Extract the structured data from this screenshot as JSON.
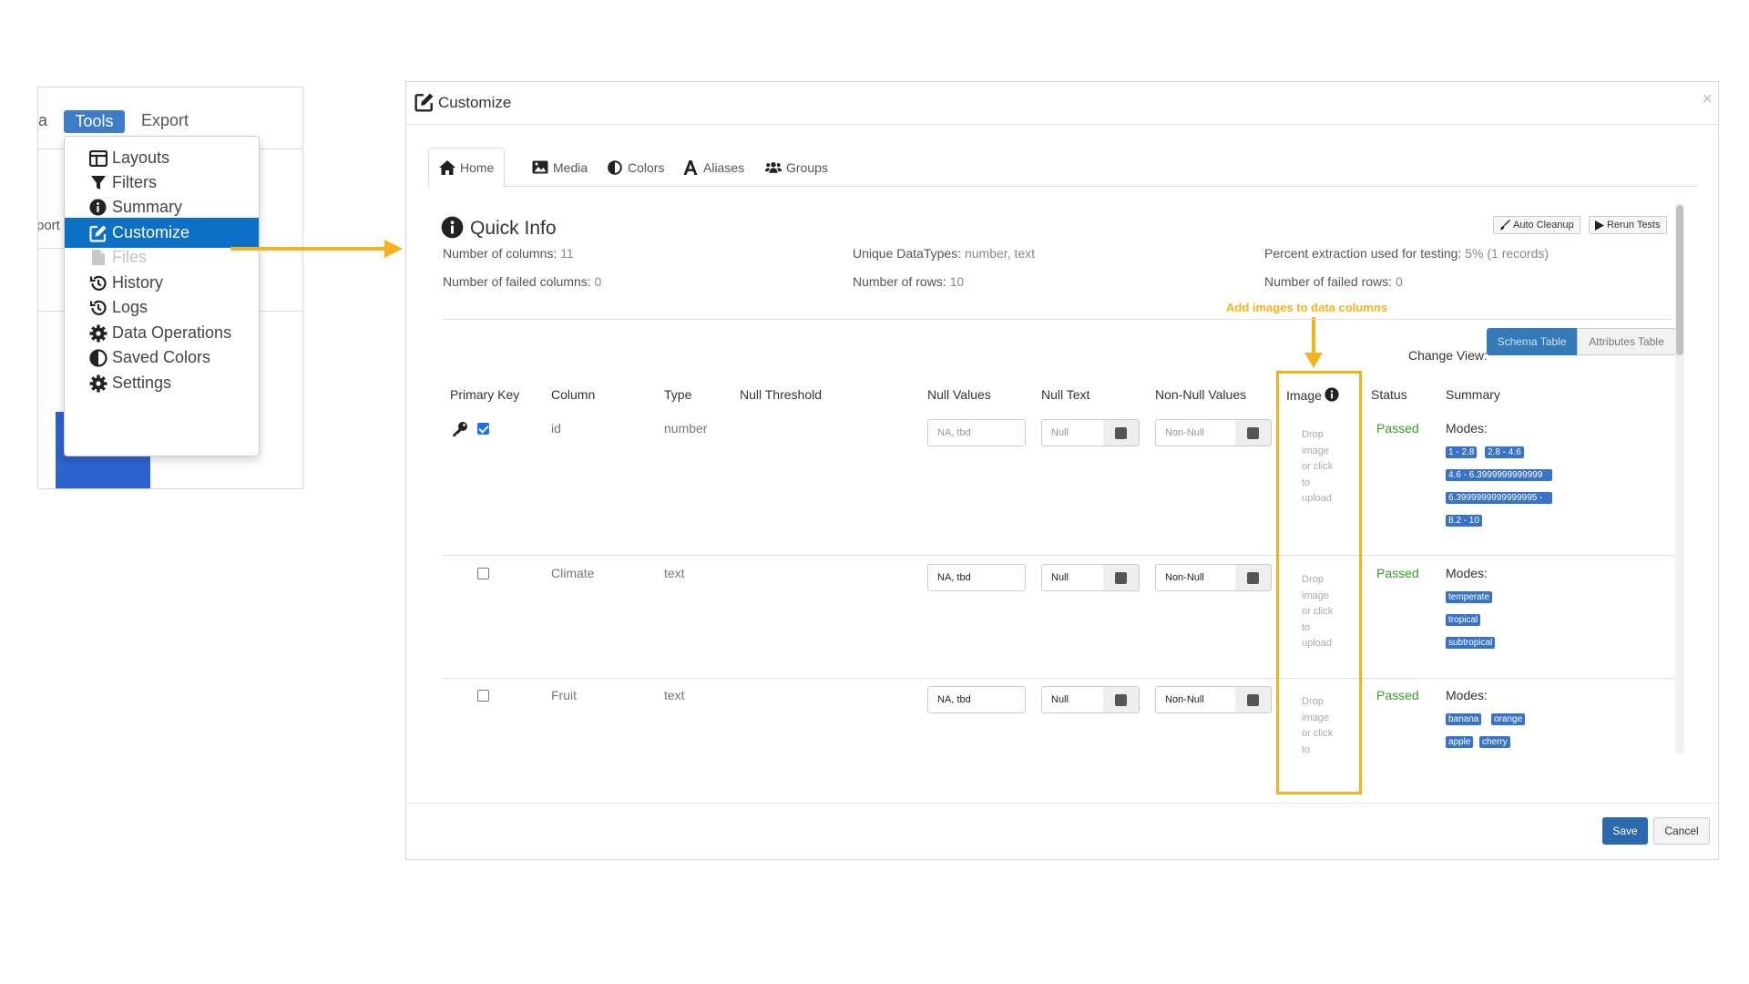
{
  "left_panel": {
    "clipped_left_text": "a",
    "menu_tools": "Tools",
    "menu_export": "Export",
    "clipped_export_text": "port"
  },
  "dropdown": {
    "items": [
      {
        "label": "Layouts",
        "icon": "layout-icon",
        "state": "normal"
      },
      {
        "label": "Filters",
        "icon": "filter-icon",
        "state": "normal"
      },
      {
        "label": "Summary",
        "icon": "info-circle-icon",
        "state": "normal"
      },
      {
        "label": "Customize",
        "icon": "edit-icon",
        "state": "active"
      },
      {
        "label": "Files",
        "icon": "file-icon",
        "state": "disabled"
      },
      {
        "label": "History",
        "icon": "history-icon",
        "state": "normal"
      },
      {
        "label": "Logs",
        "icon": "history-icon",
        "state": "normal"
      },
      {
        "label": "Data Operations",
        "icon": "gear-icon",
        "state": "normal"
      },
      {
        "label": "Saved Colors",
        "icon": "contrast-icon",
        "state": "normal"
      },
      {
        "label": "Settings",
        "icon": "gear-icon",
        "state": "normal"
      }
    ]
  },
  "modal": {
    "title": "Customize",
    "close": "×",
    "tabs": [
      {
        "label": "Home",
        "icon": "home-icon",
        "active": true
      },
      {
        "label": "Media",
        "icon": "image-icon",
        "active": false
      },
      {
        "label": "Colors",
        "icon": "contrast-icon",
        "active": false
      },
      {
        "label": "Aliases",
        "icon": "font-icon",
        "active": false
      },
      {
        "label": "Groups",
        "icon": "users-icon",
        "active": false
      }
    ],
    "quick_info": {
      "title": "Quick Info",
      "num_columns_label": "Number of columns: ",
      "num_columns_value": "11",
      "num_failed_columns_label": "Number of failed columns: ",
      "num_failed_columns_value": "0",
      "unique_datatypes_label": "Unique DataTypes: ",
      "unique_datatypes_value": "number, text",
      "num_rows_label": "Number of rows: ",
      "num_rows_value": "10",
      "percent_extraction_label": "Percent extraction used for testing: ",
      "percent_extraction_value": "5% (1 records)",
      "num_failed_rows_label": "Number of failed rows: ",
      "num_failed_rows_value": "0",
      "auto_cleanup": "Auto Cleanup",
      "rerun_tests": "Rerun Tests"
    },
    "annotation": "Add images to data columns",
    "change_view": {
      "label": "Change View:",
      "schema_table": "Schema Table",
      "attributes_table": "Attributes Table"
    },
    "table": {
      "headers": {
        "primary_key": "Primary Key",
        "column": "Column",
        "type": "Type",
        "null_threshold": "Null Threshold",
        "null_values": "Null Values",
        "null_text": "Null Text",
        "non_null_values": "Non-Null Values",
        "image": "Image",
        "status": "Status",
        "summary": "Summary"
      },
      "rows": [
        {
          "column": "id",
          "type": "number",
          "primary_key": true,
          "null_values": "NA, tbd",
          "null_text": "Null",
          "non_null_values": "Non-Null",
          "placeholders": true,
          "drop_text": [
            "Drop",
            "image",
            "or click",
            "to",
            "upload"
          ],
          "status": "Passed",
          "modes_label": "Modes:",
          "modes": [
            "1 - 2.8",
            "2.8 - 4.6",
            "4.6 - 6.3999999999999",
            "6.3999999999999995 -",
            "8.2 - 10"
          ]
        },
        {
          "column": "Climate",
          "type": "text",
          "primary_key": false,
          "null_values": "NA, tbd",
          "null_text": "Null",
          "non_null_values": "Non-Null",
          "placeholders": false,
          "drop_text": [
            "Drop",
            "image",
            "or click",
            "to",
            "upload"
          ],
          "status": "Passed",
          "modes_label": "Modes:",
          "modes": [
            "temperate",
            "tropical",
            "subtropical"
          ]
        },
        {
          "column": "Fruit",
          "type": "text",
          "primary_key": false,
          "null_values": "NA, tbd",
          "null_text": "Null",
          "non_null_values": "Non-Null",
          "placeholders": false,
          "drop_text": [
            "Drop",
            "image",
            "or click",
            "to"
          ],
          "status": "Passed",
          "modes_label": "Modes:",
          "modes": [
            "banana",
            "orange",
            "apple",
            "cherry"
          ]
        }
      ]
    },
    "footer": {
      "save": "Save",
      "cancel": "Cancel"
    }
  },
  "colors": {
    "accent_orange": "#f5b21c",
    "active_blue": "#0d70c7",
    "badge_blue": "#3873c7",
    "passed_green": "#3d9a2e"
  }
}
